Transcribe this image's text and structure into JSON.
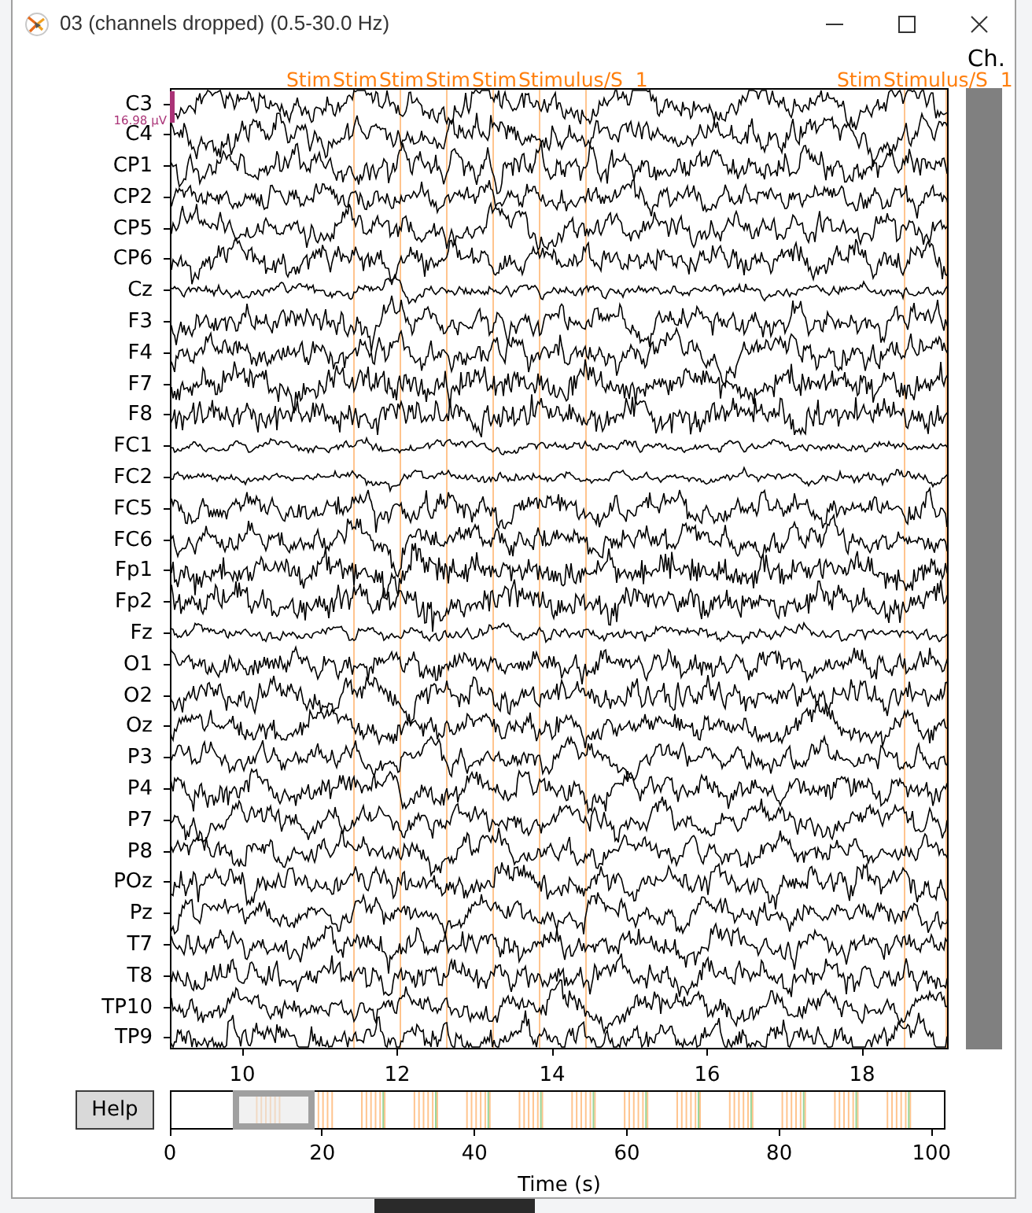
{
  "window": {
    "title": "03 (channels dropped) (0.5-30.0 Hz)"
  },
  "plot": {
    "annotation_groups": [
      {
        "labels": [
          "Stim",
          "Stim",
          "Stim",
          "Stim",
          "Stim",
          "Stimulus/S  1"
        ]
      },
      {
        "labels": [
          "Stim",
          "Stimulus/S  1"
        ]
      }
    ],
    "scrollbar_label": "Ch.",
    "scale_label": "16.98 µV",
    "channels": [
      "C3",
      "C4",
      "CP1",
      "CP2",
      "CP5",
      "CP6",
      "Cz",
      "F3",
      "F4",
      "F7",
      "F8",
      "FC1",
      "FC2",
      "FC5",
      "FC6",
      "Fp1",
      "Fp2",
      "Fz",
      "O1",
      "O2",
      "Oz",
      "P3",
      "P4",
      "P7",
      "P8",
      "POz",
      "Pz",
      "T7",
      "T8",
      "TP10",
      "TP9"
    ],
    "xticks": [
      "10",
      "12",
      "14",
      "16",
      "18"
    ]
  },
  "overview": {
    "help_button": "Help",
    "ticks": [
      "0",
      "20",
      "40",
      "60",
      "80",
      "100"
    ],
    "xlabel": "Time (s)"
  }
}
